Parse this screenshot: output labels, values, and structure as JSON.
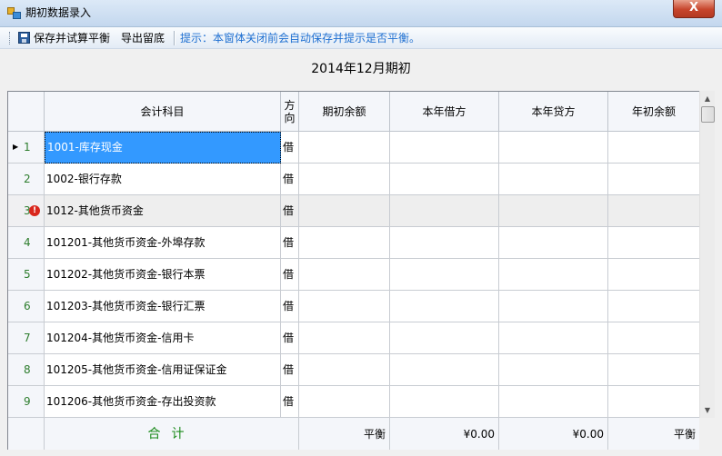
{
  "window": {
    "title": "期初数据录入",
    "close_label": "X"
  },
  "toolbar": {
    "save_label": "保存并试算平衡",
    "export_label": "导出留底",
    "hint": "提示：本窗体关闭前会自动保存并提示是否平衡。"
  },
  "period_title": "2014年12月期初",
  "columns": {
    "account": "会计科目",
    "direction": "方向",
    "opening_balance": "期初余额",
    "year_debit": "本年借方",
    "year_credit": "本年贷方",
    "year_start_balance": "年初余额"
  },
  "rows": [
    {
      "no": "1",
      "account": "1001-库存现金",
      "direction": "借"
    },
    {
      "no": "2",
      "account": "1002-银行存款",
      "direction": "借"
    },
    {
      "no": "3",
      "account": "1012-其他货币资金",
      "direction": "借"
    },
    {
      "no": "4",
      "account": "101201-其他货币资金-外埠存款",
      "direction": "借"
    },
    {
      "no": "5",
      "account": "101202-其他货币资金-银行本票",
      "direction": "借"
    },
    {
      "no": "6",
      "account": "101203-其他货币资金-银行汇票",
      "direction": "借"
    },
    {
      "no": "7",
      "account": "101204-其他货币资金-信用卡",
      "direction": "借"
    },
    {
      "no": "8",
      "account": "101205-其他货币资金-信用证保证金",
      "direction": "借"
    },
    {
      "no": "9",
      "account": "101206-其他货币资金-存出投资款",
      "direction": "借"
    }
  ],
  "summary": {
    "label": "合计",
    "opening_balance": "平衡",
    "year_debit": "¥0.00",
    "year_credit": "¥0.00",
    "year_start_balance": "平衡"
  },
  "colors": {
    "selection": "#3399ff",
    "hint_text": "#1e6fd1",
    "summary_label": "#1a8a1a",
    "error_badge": "#d9261c"
  },
  "icons": {
    "save": "save-icon",
    "error": "error-icon",
    "current_row": "current-row-arrow-icon"
  }
}
